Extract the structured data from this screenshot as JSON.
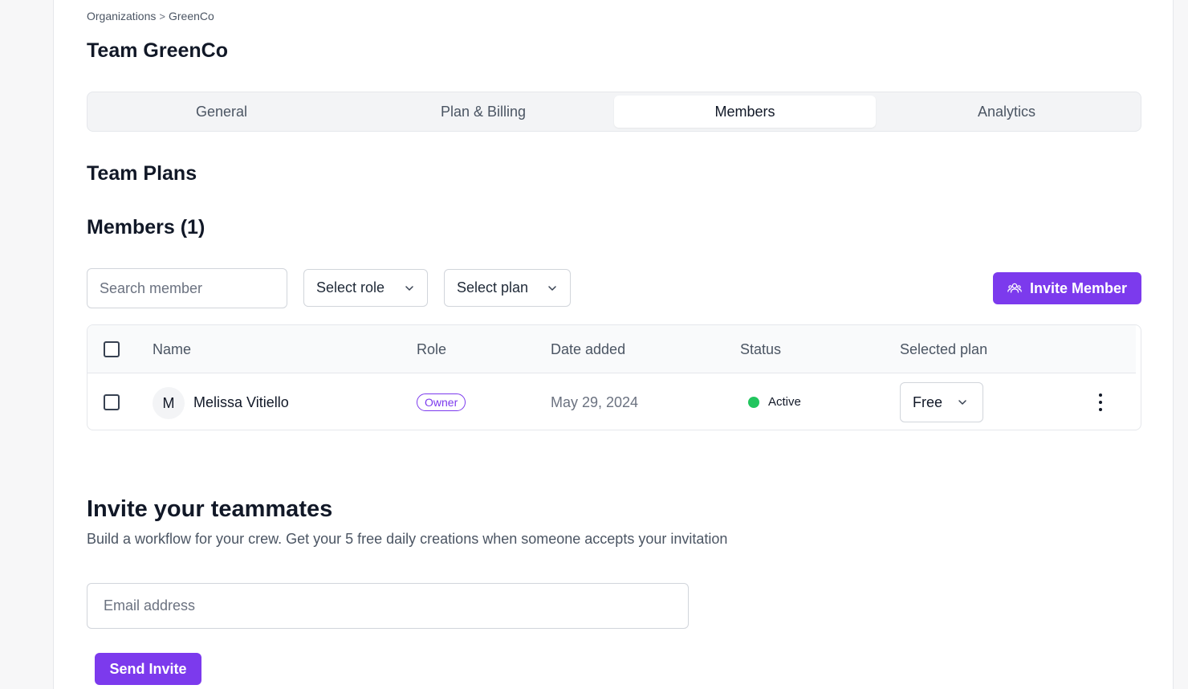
{
  "breadcrumb": {
    "root": "Organizations",
    "separator": ">",
    "current": "GreenCo"
  },
  "page": {
    "title": "Team GreenCo"
  },
  "tabs": [
    {
      "label": "General",
      "active": false
    },
    {
      "label": "Plan & Billing",
      "active": false
    },
    {
      "label": "Members",
      "active": true
    },
    {
      "label": "Analytics",
      "active": false
    }
  ],
  "team_plans": {
    "title": "Team Plans"
  },
  "members": {
    "title": "Members (1)",
    "search_placeholder": "Search member",
    "role_select_label": "Select role",
    "plan_select_label": "Select plan",
    "invite_button_label": "Invite Member",
    "columns": [
      "Name",
      "Role",
      "Date added",
      "Status",
      "Selected plan"
    ],
    "rows": [
      {
        "avatar_initial": "M",
        "name": "Melissa Vitiello",
        "role": "Owner",
        "date_added": "May 29, 2024",
        "status": "Active",
        "selected_plan": "Free"
      }
    ]
  },
  "invite": {
    "title": "Invite your teammates",
    "subtitle": "Build a workflow for your crew. Get your 5 free daily creations when someone accepts your invitation",
    "email_placeholder": "Email address",
    "send_button_label": "Send Invite"
  },
  "colors": {
    "accent": "#7c3aed",
    "status_active": "#22c55e",
    "border": "#e5e7eb"
  },
  "icons": {
    "invite_button_icon": "users-icon",
    "dropdown_icon": "chevron-down-icon",
    "row_actions_icon": "more-vertical-icon"
  }
}
